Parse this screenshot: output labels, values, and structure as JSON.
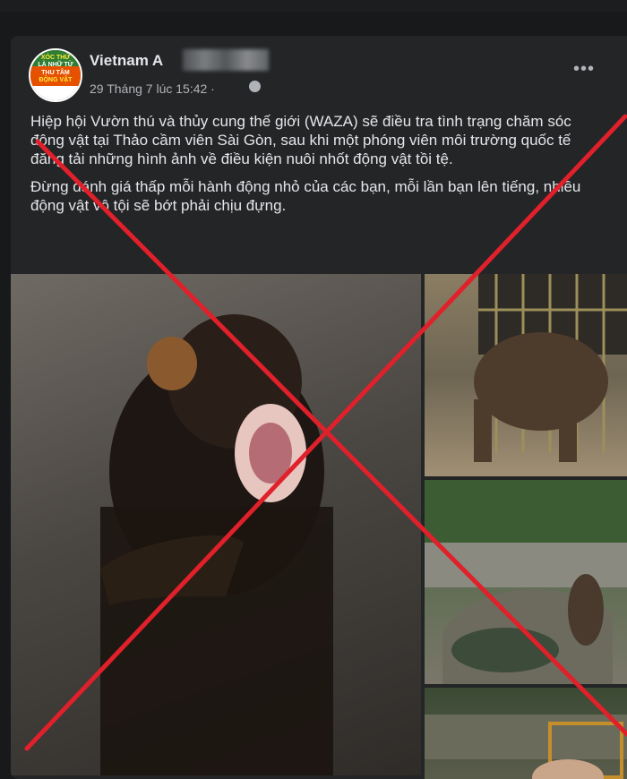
{
  "post": {
    "author": "Vietnam A",
    "timestamp": "29 Tháng 7 lúc 15:42 ·",
    "more_label": "•••",
    "paragraphs": [
      "Hiệp hội Vườn thú và thủy cung thế giới (WAZA) sẽ điều tra tình trạng chăm sóc động vật tại Thảo cầm viên Sài Gòn, sau khi một phóng viên môi trường quốc tế đăng tải những hình ảnh về điều kiện nuôi nhốt động vật tồi tệ.",
      "Đừng đánh giá thấp mỗi hành động nhỏ của các bạn, mỗi lần bạn lên tiếng, nhiều động vật vô tội sẽ bớt phải chịu đựng."
    ]
  },
  "avatar": {
    "line1": "XÓC THỬ",
    "line2": "LÀ NHỮ TỪ",
    "line3": "THU TÂM",
    "line4": "ĐỘNG VẬT"
  },
  "overlay": {
    "cross_color": "#e0202a"
  },
  "icons": {
    "privacy": "globe-icon",
    "menu": "more-options-icon"
  }
}
